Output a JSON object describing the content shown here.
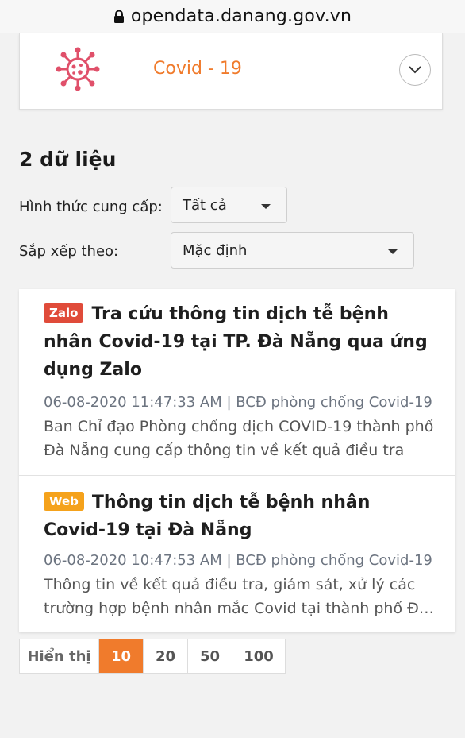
{
  "browser": {
    "url": "opendata.danang.gov.vn"
  },
  "topic": {
    "icon": "virus-icon",
    "title": "Covid - 19",
    "accent": "#f07b2c"
  },
  "results": {
    "count_label": "2 dữ liệu"
  },
  "filters": {
    "provider_label": "Hình thức cung cấp:",
    "provider_value": "Tất cả",
    "sort_label": "Sắp xếp theo:",
    "sort_value": "Mặc định"
  },
  "items": [
    {
      "badge": "Zalo",
      "badge_color": "#e04b3a",
      "title": "Tra cứu thông tin dịch tễ bệnh nhân Covid-19 tại TP. Đà Nẵng qua ứng dụng Zalo",
      "meta": "06-08-2020 11:47:33 AM | BCĐ phòng chống Covid-19",
      "description": "Ban Chỉ đạo Phòng chống dịch COVID-19 thành phố Đà Nẵng cung cấp thông tin về kết quả điều tra"
    },
    {
      "badge": "Web",
      "badge_color": "#f5a21b",
      "title": "Thông tin dịch tễ bệnh nhân Covid-19 tại Đà Nẵng",
      "meta": "06-08-2020 10:47:53 AM | BCĐ phòng chống Covid-19",
      "description": "Thông tin về kết quả điều tra, giám sát, xử lý các trường hợp bệnh nhân mắc Covid tại thành phố Đà Nẵng"
    }
  ],
  "pagination": {
    "label": "Hiển thị",
    "options": [
      "10",
      "20",
      "50",
      "100"
    ],
    "active": "10"
  }
}
